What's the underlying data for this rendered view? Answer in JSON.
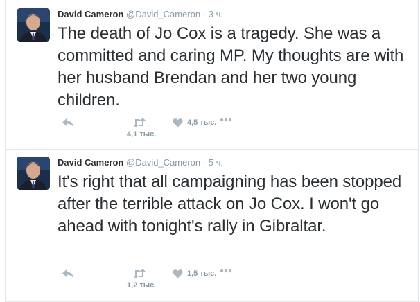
{
  "colors": {
    "text": "#292f33",
    "muted": "#8899a6",
    "border": "#e1e8ed",
    "icon": "#aab8c2"
  },
  "tweets": [
    {
      "name": "David Cameron",
      "handle": "@David_Cameron",
      "separator": "·",
      "time": "3 ч.",
      "text": "The death of Jo Cox is a tragedy. She was a committed and caring MP. My thoughts are with her husband Brendan and her two young children.",
      "retweets": "4,1 тыс.",
      "likes": "4,5 тыс.",
      "icons": [
        "reply-icon",
        "retweet-icon",
        "heart-icon",
        "more-icon"
      ]
    },
    {
      "name": "David Cameron",
      "handle": "@David_Cameron",
      "separator": "·",
      "time": "5 ч.",
      "text": "It's right that all campaigning has been stopped after the terrible attack on Jo Cox. I won't go ahead with tonight's rally in Gibraltar.",
      "retweets": "1,2 тыс.",
      "likes": "1,5 тыс.",
      "icons": [
        "reply-icon",
        "retweet-icon",
        "heart-icon",
        "more-icon"
      ]
    }
  ]
}
